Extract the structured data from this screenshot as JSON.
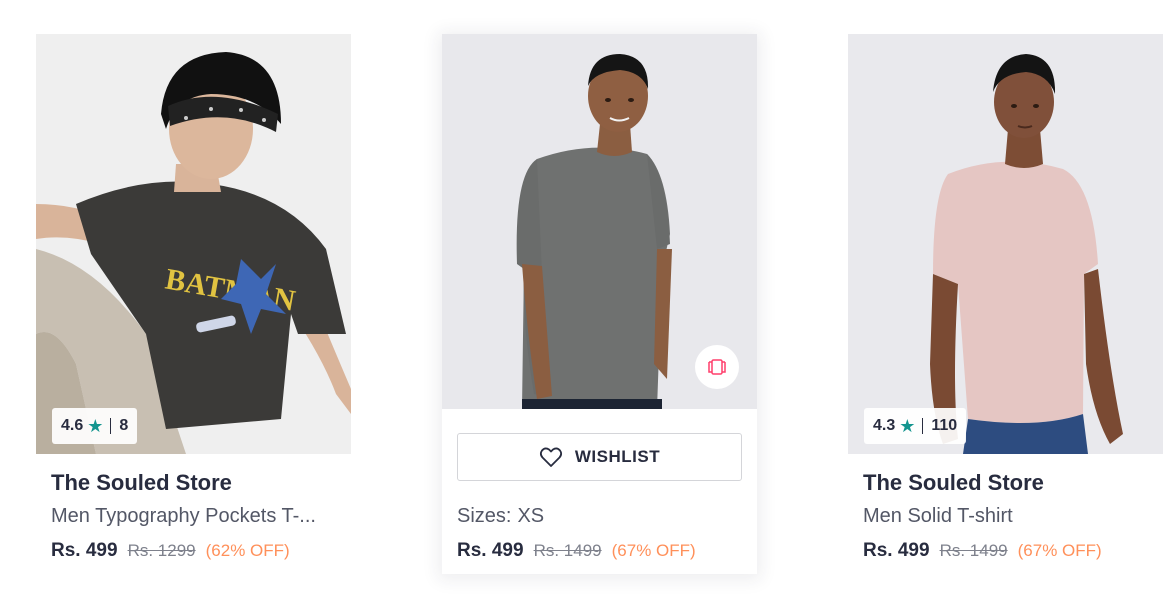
{
  "products": [
    {
      "brand": "The Souled Store",
      "name": "Men Typography Pockets T-...",
      "price": "Rs. 499",
      "mrp": "Rs. 1299",
      "discount": "(62% OFF)",
      "rating": "4.6",
      "rating_count": "8",
      "image": "man-in-black-batman-tshirt"
    },
    {
      "sizes_label": "Sizes:",
      "sizes_value": "XS",
      "wishlist_label": "WISHLIST",
      "price": "Rs. 499",
      "mrp": "Rs. 1499",
      "discount": "(67% OFF)",
      "image": "man-in-grey-tshirt"
    },
    {
      "brand": "The Souled Store",
      "name": "Men Solid T-shirt",
      "price": "Rs. 499",
      "mrp": "Rs. 1499",
      "discount": "(67% OFF)",
      "rating": "4.3",
      "rating_count": "110",
      "image": "man-in-pink-tshirt"
    }
  ],
  "colors": {
    "rating_star": "#14958f",
    "discount": "#ff905a",
    "text_primary": "#282c3f",
    "text_secondary": "#535766",
    "mrp": "#7e818c"
  },
  "icons": {
    "star": "star-icon",
    "heart": "heart-icon",
    "similar": "view-similar-icon"
  }
}
